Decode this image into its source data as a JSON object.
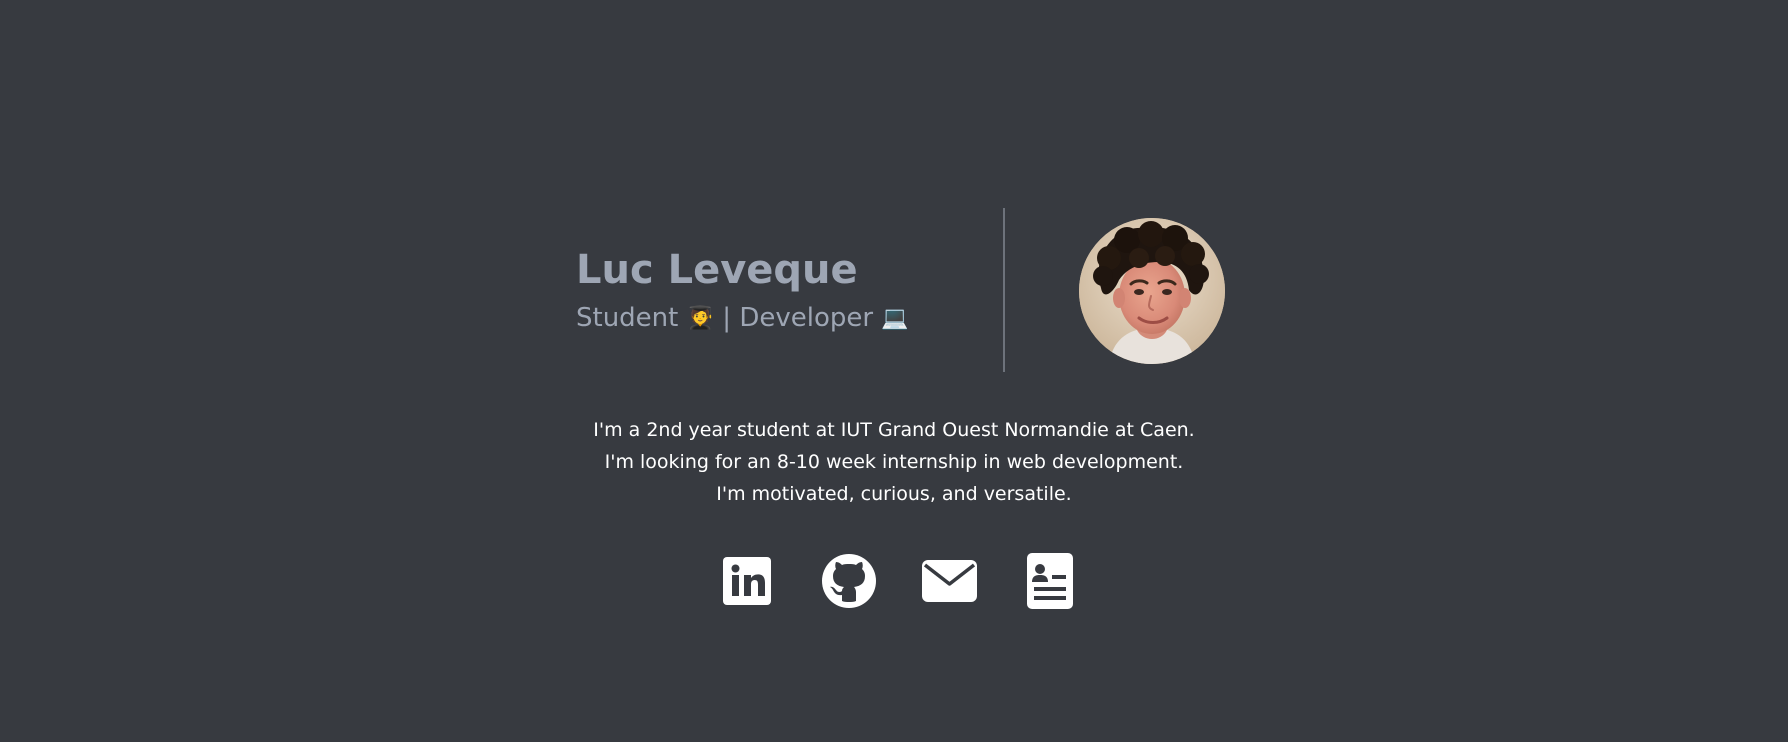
{
  "profile": {
    "name": "Luc Leveque",
    "role_student": "Student",
    "role_student_emoji": "🧑‍🎓",
    "role_separator": "|",
    "role_developer": "Developer",
    "role_developer_emoji": "💻"
  },
  "bio": {
    "lines": [
      "I'm a 2nd year student at IUT Grand Ouest Normandie at Caen.",
      "I'm looking for an 8-10 week internship in web development.",
      "I'm motivated, curious, and versatile."
    ]
  },
  "socials": [
    {
      "icon": "linkedin-icon"
    },
    {
      "icon": "github-icon"
    },
    {
      "icon": "envelope-icon"
    },
    {
      "icon": "resume-icon"
    }
  ],
  "colors": {
    "background": "#373a40",
    "name": "#9ea6b4",
    "divider": "#6d727b",
    "text": "#ffffff"
  }
}
